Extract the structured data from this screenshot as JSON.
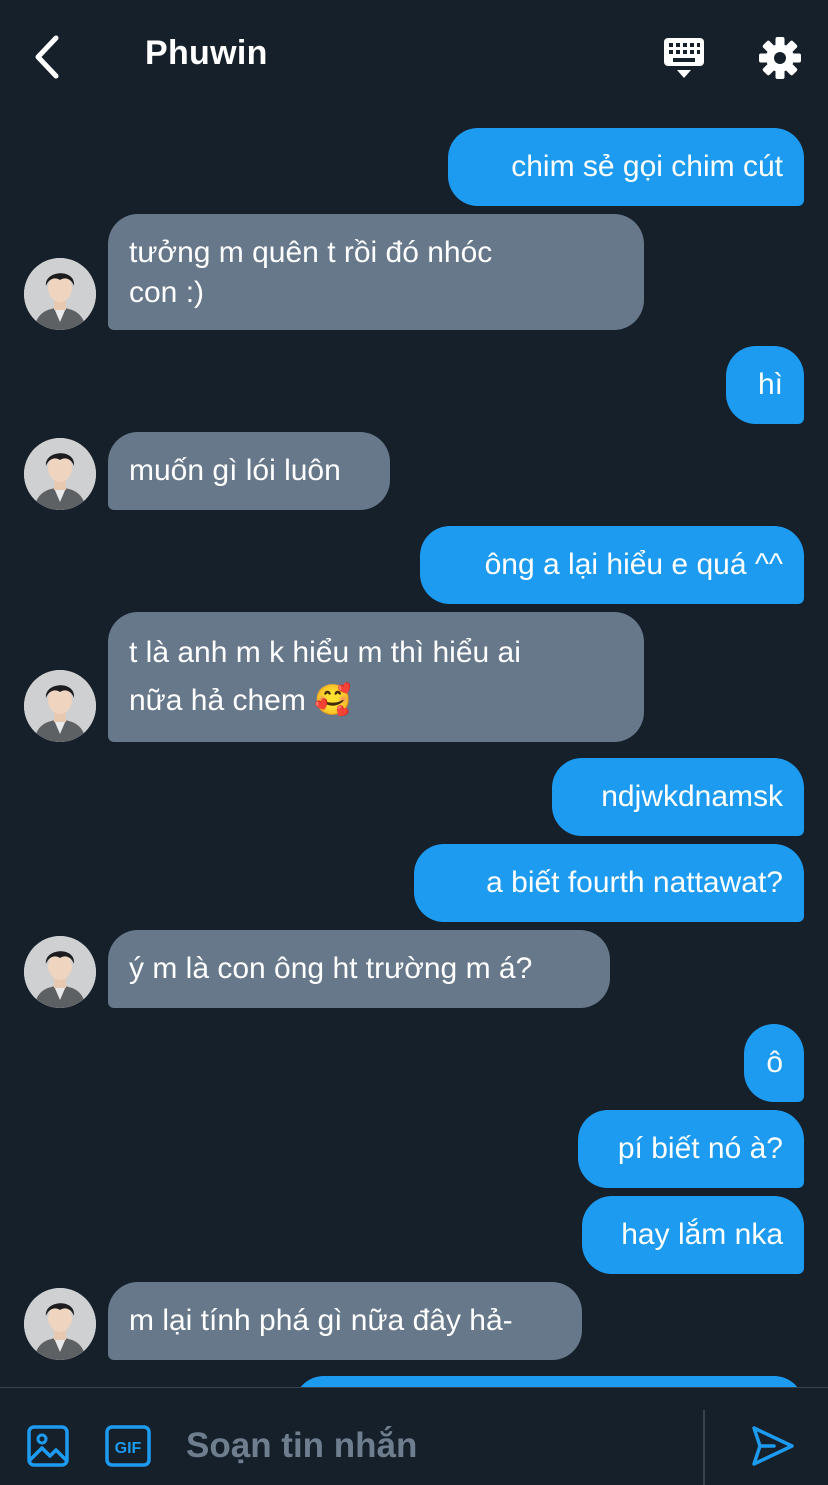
{
  "header": {
    "title": "Phuwin",
    "back_icon": "chevron-left-icon",
    "keyboard_icon": "keyboard-icon",
    "settings_icon": "gear-icon"
  },
  "messages": [
    {
      "from": "me",
      "text": "chim sẻ gọi chim cút"
    },
    {
      "from": "them",
      "text": "tưởng m quên t rồi đó nhóc\ncon :)"
    },
    {
      "from": "me",
      "text": "hì"
    },
    {
      "from": "them",
      "text": "muốn gì lói luôn"
    },
    {
      "from": "me",
      "text": "ông a lại hiểu e quá ^^"
    },
    {
      "from": "them",
      "text": "t là anh m k hiểu m thì hiểu ai\nnữa hả chem 🥰"
    },
    {
      "from": "me",
      "text": "ndjwkdnamsk"
    },
    {
      "from": "me",
      "text": "a biết fourth nattawat?"
    },
    {
      "from": "them",
      "text": "ý m là con ông ht trường m á?"
    },
    {
      "from": "me",
      "text": "ô"
    },
    {
      "from": "me",
      "text": "pí biết nó à?"
    },
    {
      "from": "me",
      "text": "hay lắm nka"
    },
    {
      "from": "them",
      "text": "m lại tính phá gì nữa đây hả-"
    },
    {
      "from": "me",
      "text": ""
    }
  ],
  "composer": {
    "placeholder": "Soạn tin nhắn",
    "image_icon": "image-icon",
    "gif_icon": "gif-icon",
    "gif_label": "GIF",
    "send_icon": "send-icon"
  },
  "colors": {
    "background": "#16202b",
    "sent_bubble": "#1d9bf0",
    "received_bubble": "#66788a",
    "accent": "#1d9bf0"
  }
}
